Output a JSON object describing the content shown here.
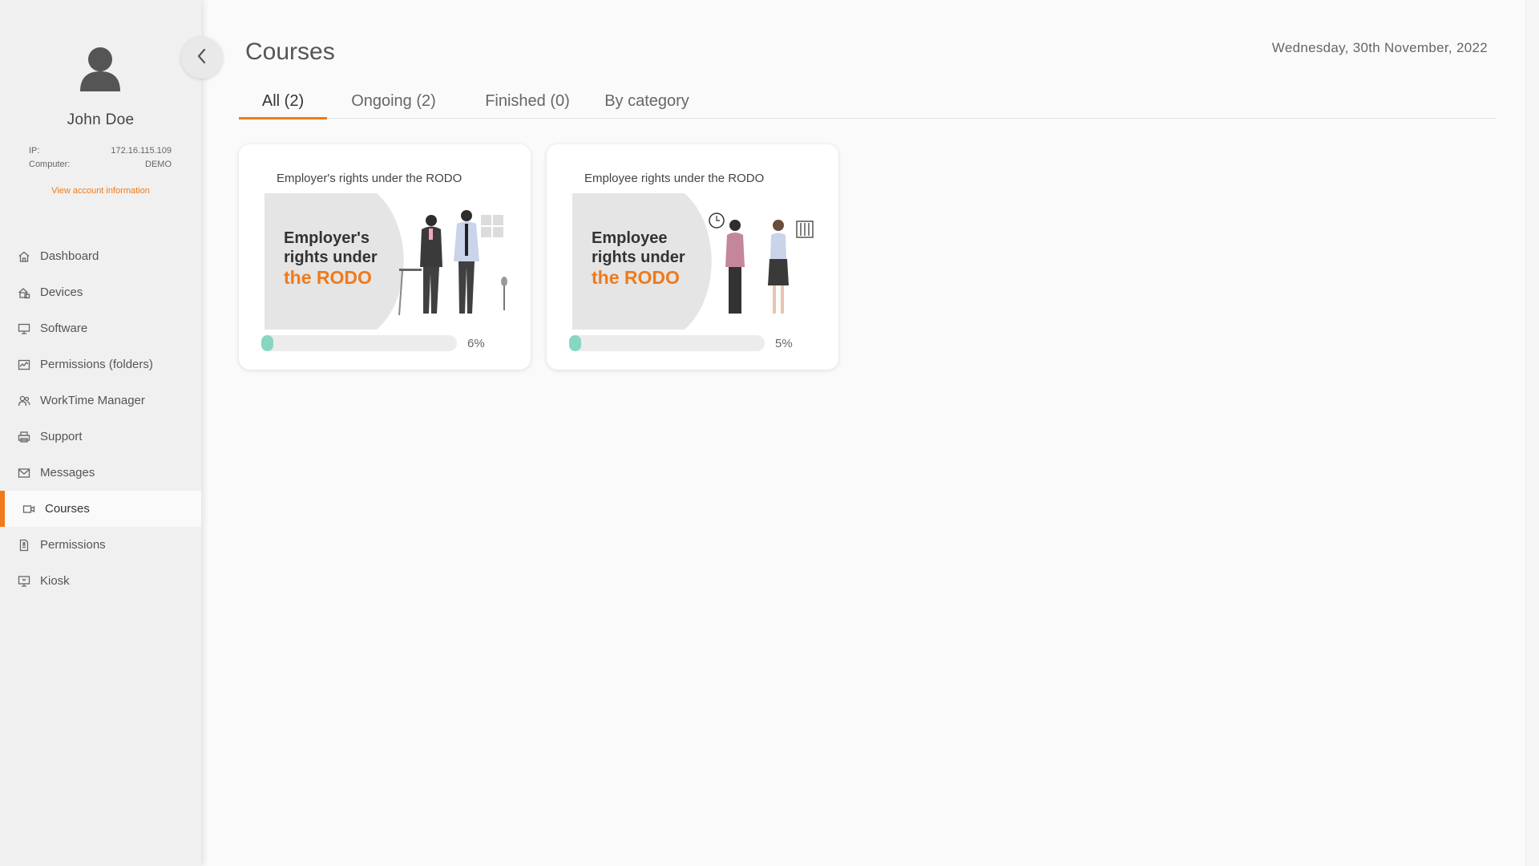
{
  "user": {
    "name": "John Doe",
    "ip_label": "IP:",
    "ip_value": "172.16.115.109",
    "computer_label": "Computer:",
    "computer_value": "DEMO",
    "account_link": "View account information"
  },
  "nav": {
    "items": [
      {
        "label": "Dashboard",
        "icon": "home-icon"
      },
      {
        "label": "Devices",
        "icon": "devices-icon"
      },
      {
        "label": "Software",
        "icon": "monitor-icon"
      },
      {
        "label": "Permissions (folders)",
        "icon": "activity-icon"
      },
      {
        "label": "WorkTime Manager",
        "icon": "users-icon"
      },
      {
        "label": "Support",
        "icon": "printer-icon"
      },
      {
        "label": "Messages",
        "icon": "mail-icon"
      },
      {
        "label": "Courses",
        "icon": "video-icon"
      },
      {
        "label": "Permissions",
        "icon": "document-icon"
      },
      {
        "label": "Kiosk",
        "icon": "kiosk-icon"
      }
    ],
    "active_label": "Courses"
  },
  "header": {
    "title": "Courses",
    "date": "Wednesday, 30th November, 2022"
  },
  "tabs": [
    {
      "label": "All (2)",
      "active": true
    },
    {
      "label": "Ongoing (2)",
      "active": false
    },
    {
      "label": "Finished (0)",
      "active": false
    },
    {
      "label": "By category",
      "active": false
    }
  ],
  "courses": [
    {
      "title": "Employer's rights under the RODO",
      "banner_line1": "Employer's",
      "banner_line2": "rights under",
      "banner_line3": "the RODO",
      "progress": 6,
      "progress_label": "6%"
    },
    {
      "title": "Employee rights under the RODO",
      "banner_line1": "Employee",
      "banner_line2": "rights under",
      "banner_line3": "the RODO",
      "progress": 5,
      "progress_label": "5%"
    }
  ],
  "colors": {
    "accent": "#f07a1a",
    "progress": "#86d6c2",
    "sidebar_bg": "#f0f0f0",
    "page_bg": "#fafafa"
  }
}
